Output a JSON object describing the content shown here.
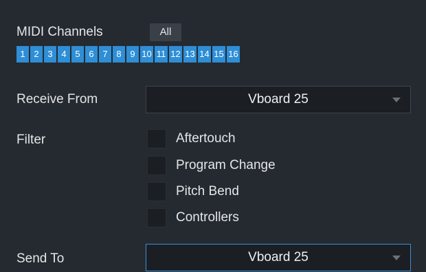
{
  "midi_channels": {
    "label": "MIDI Channels",
    "all_button": "All",
    "channels": [
      "1",
      "2",
      "3",
      "4",
      "5",
      "6",
      "7",
      "8",
      "9",
      "10",
      "11",
      "12",
      "13",
      "14",
      "15",
      "16"
    ],
    "selected_color": "#2e8ed6"
  },
  "receive_from": {
    "label": "Receive From",
    "value": "Vboard 25"
  },
  "filter": {
    "label": "Filter",
    "options": [
      {
        "label": "Aftertouch",
        "checked": false
      },
      {
        "label": "Program Change",
        "checked": false
      },
      {
        "label": "Pitch Bend",
        "checked": false
      },
      {
        "label": "Controllers",
        "checked": false
      }
    ]
  },
  "send_to": {
    "label": "Send To",
    "value": "Vboard 25"
  }
}
